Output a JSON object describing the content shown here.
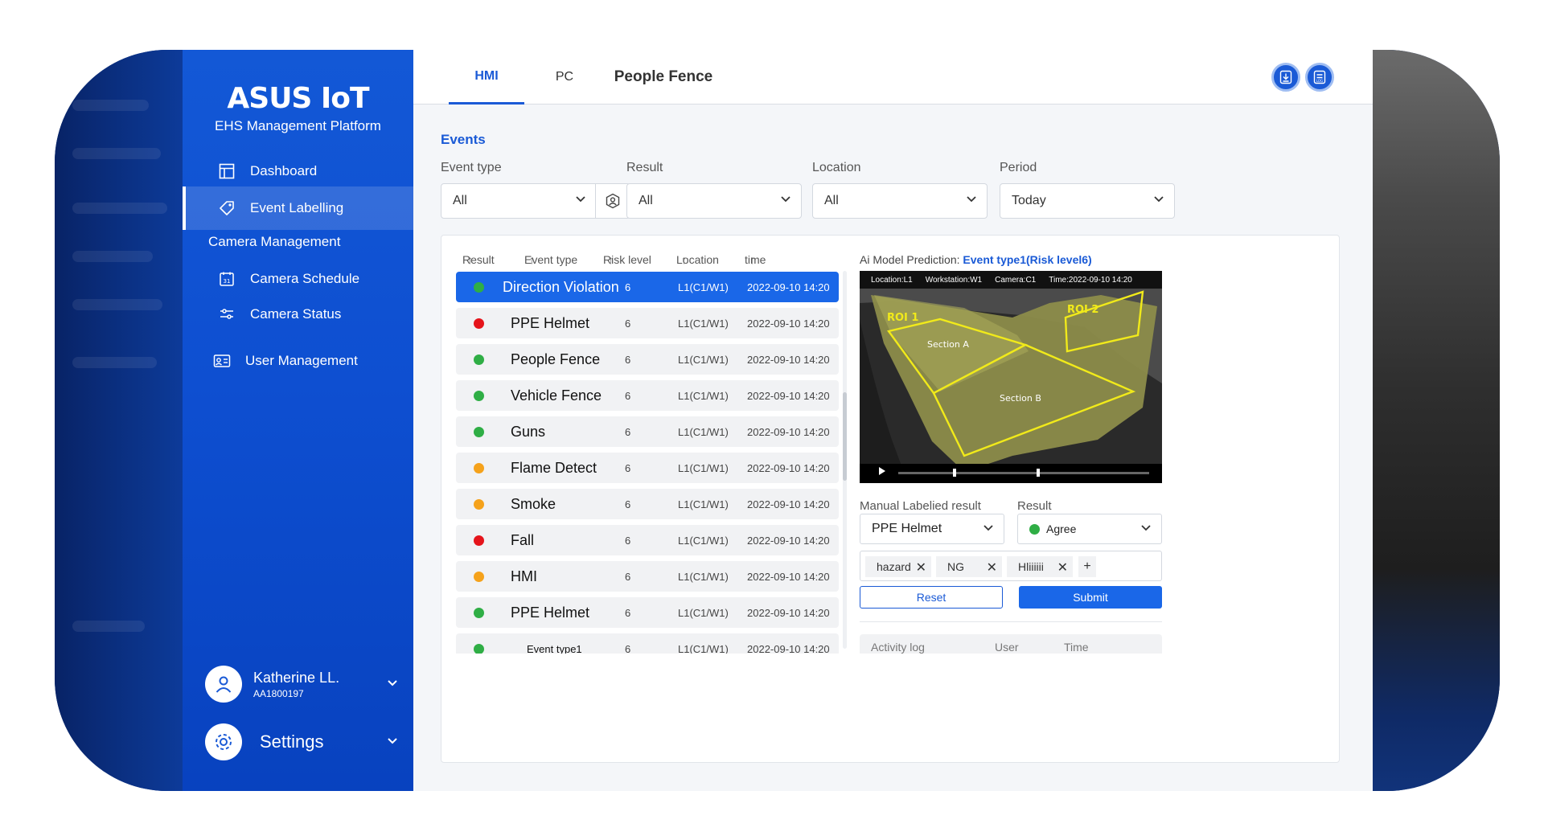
{
  "brand": {
    "logo": "ASUS IoT",
    "subtitle": "EHS Management Platform"
  },
  "sidebar": {
    "items": [
      {
        "label": "Dashboard",
        "icon": "dashboard-icon"
      },
      {
        "label": "Event Labelling",
        "icon": "tag-icon",
        "active": true
      },
      {
        "label": "Camera Schedule",
        "icon": "calendar-icon"
      },
      {
        "label": "Camera Status",
        "icon": "sliders-icon"
      },
      {
        "label": "User Management",
        "icon": "id-card-icon"
      }
    ],
    "section_camera": "Camera Management"
  },
  "user": {
    "name": "Katherine LL.",
    "id": "AA1800197"
  },
  "settings": {
    "label": "Settings"
  },
  "tabs": [
    {
      "label": "HMI",
      "active": true
    },
    {
      "label": "PC"
    },
    {
      "label": "People Fence"
    }
  ],
  "events": {
    "title": "Events",
    "filters": {
      "event_type": {
        "label": "Event type",
        "value": "All"
      },
      "result": {
        "label": "Result",
        "value": "All"
      },
      "location": {
        "label": "Location",
        "value": "All"
      },
      "period": {
        "label": "Period",
        "value": "Today"
      }
    }
  },
  "table": {
    "columns": [
      "Result",
      "Event type",
      "Risk level",
      "Location",
      "time"
    ],
    "rows": [
      {
        "status_color": "#2fae45",
        "event": "Direction Violation",
        "risk": "6",
        "location": "L1(C1/W1)",
        "time": "2022-09-10 14:20",
        "selected": true
      },
      {
        "status_color": "#e5141b",
        "event": "PPE Helmet",
        "risk": "6",
        "location": "L1(C1/W1)",
        "time": "2022-09-10 14:20"
      },
      {
        "status_color": "#2fae45",
        "event": "People Fence",
        "risk": "6",
        "location": "L1(C1/W1)",
        "time": "2022-09-10 14:20"
      },
      {
        "status_color": "#2fae45",
        "event": "Vehicle Fence",
        "risk": "6",
        "location": "L1(C1/W1)",
        "time": "2022-09-10 14:20"
      },
      {
        "status_color": "#2fae45",
        "event": "Guns",
        "risk": "6",
        "location": "L1(C1/W1)",
        "time": "2022-09-10 14:20"
      },
      {
        "status_color": "#f5a21b",
        "event": "Flame Detect",
        "risk": "6",
        "location": "L1(C1/W1)",
        "time": "2022-09-10 14:20"
      },
      {
        "status_color": "#f5a21b",
        "event": "Smoke",
        "risk": "6",
        "location": "L1(C1/W1)",
        "time": "2022-09-10 14:20"
      },
      {
        "status_color": "#e5141b",
        "event": "Fall",
        "risk": "6",
        "location": "L1(C1/W1)",
        "time": "2022-09-10 14:20"
      },
      {
        "status_color": "#f5a21b",
        "event": "HMI",
        "risk": "6",
        "location": "L1(C1/W1)",
        "time": "2022-09-10 14:20"
      },
      {
        "status_color": "#2fae45",
        "event": "PPE Helmet",
        "risk": "6",
        "location": "L1(C1/W1)",
        "time": "2022-09-10 14:20"
      },
      {
        "status_color": "#2fae45",
        "event": "Event type1",
        "risk": "6",
        "location": "L1(C1/W1)",
        "time": "2022-09-10 14:20"
      }
    ]
  },
  "prediction": {
    "label": "Ai Model Prediction:",
    "value": "Event type1(Risk level6)"
  },
  "camera": {
    "location": "Location:L1",
    "workstation": "Workstation:W1",
    "camera": "Camera:C1",
    "time": "Time:2022-09-10 14:20",
    "roi1": "ROI 1",
    "roi2": "ROI 2",
    "section_a": "Section A",
    "section_b": "Section B"
  },
  "manual": {
    "label": "Manual Labelied result",
    "value": "PPE Helmet",
    "result_label": "Result",
    "result_value": "Agree",
    "result_color": "#2fae45",
    "tags": [
      "hazard",
      "NG",
      "Hliiiiii"
    ],
    "reset": "Reset",
    "submit": "Submit"
  },
  "activity_log": {
    "title": "Activity log",
    "user": "User",
    "time": "Time"
  },
  "colors": {
    "accent": "#1a5ad6",
    "sidebar": "#0e4fd1"
  }
}
